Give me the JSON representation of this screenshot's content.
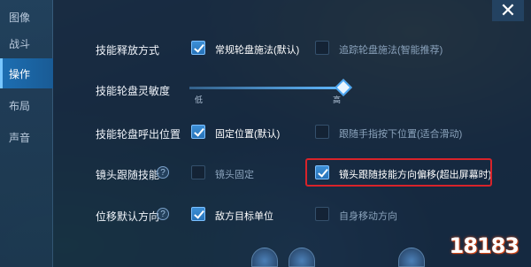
{
  "sidebar": {
    "items": [
      {
        "label": "图像"
      },
      {
        "label": "战斗"
      },
      {
        "label": "操作"
      },
      {
        "label": "布局"
      },
      {
        "label": "声音"
      }
    ]
  },
  "header": {
    "close_icon": "✕"
  },
  "settings": {
    "skill_cast_mode": {
      "label": "技能释放方式",
      "option_a": "常规轮盘施法(默认)",
      "option_b": "追踪轮盘施法(智能推荐)"
    },
    "wheel_sensitivity": {
      "label": "技能轮盘灵敏度",
      "low": "低",
      "high": "高",
      "value_fraction": 1.0
    },
    "wheel_position": {
      "label": "技能轮盘呼出位置",
      "option_a": "固定位置(默认)",
      "option_b": "跟随手指按下位置(适合滑动)"
    },
    "camera_follow": {
      "label": "镜头跟随技能",
      "help": "?",
      "option_a": "镜头固定",
      "option_b": "镜头跟随技能方向偏移(超出屏幕时)"
    },
    "displacement_direction": {
      "label": "位移默认方向",
      "help": "?",
      "option_a": "敌方目标单位",
      "option_b": "自身移动方向"
    }
  },
  "watermark": "18183",
  "colors": {
    "accent": "#2f86cf",
    "highlight_border": "#d8232a"
  }
}
